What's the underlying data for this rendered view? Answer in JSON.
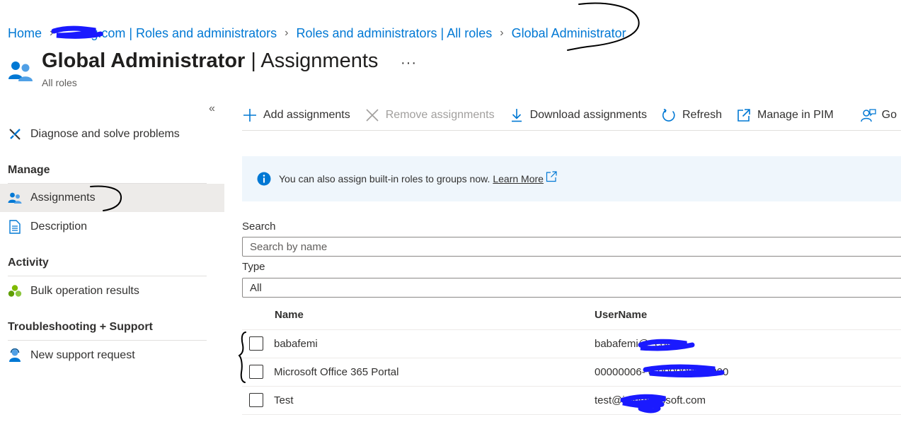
{
  "breadcrumb": {
    "items": [
      {
        "label": "Home"
      },
      {
        "label": "g.com | Roles and administrators"
      },
      {
        "label": "Roles and administrators | All roles"
      },
      {
        "label": "Global Administrator"
      }
    ]
  },
  "header": {
    "title_bold": "Global Administrator",
    "title_rest": " | Assignments",
    "more": "···",
    "subtitle": "All roles"
  },
  "sidebar": {
    "collapse": "«",
    "diagnose": "Diagnose and solve problems",
    "manage_heading": "Manage",
    "assignments": "Assignments",
    "description": "Description",
    "activity_heading": "Activity",
    "bulk": "Bulk operation results",
    "troubleshooting_heading": "Troubleshooting + Support",
    "support": "New support request"
  },
  "toolbar": {
    "add": "Add assignments",
    "remove": "Remove assignments",
    "download": "Download assignments",
    "refresh": "Refresh",
    "pim": "Manage in PIM",
    "got": "Go"
  },
  "info": {
    "text": "You can also assign built-in roles to groups now.",
    "link": "Learn More"
  },
  "filters": {
    "search_label": "Search",
    "search_placeholder": "Search by name",
    "type_label": "Type",
    "type_value": "All"
  },
  "table": {
    "headers": {
      "name": "Name",
      "username": "UserName"
    },
    "rows": [
      {
        "name": "babafemi",
        "username": "babafemi@              .com"
      },
      {
        "name": "Microsoft Office 365 Portal",
        "username": "00000006-                    0-000000000000"
      },
      {
        "name": "Test",
        "username": "test@i                onmicrosoft.com"
      }
    ]
  },
  "colors": {
    "link": "#0078d4",
    "info_bg": "#eff6fc",
    "active_bg": "#edebe9",
    "redaction": "#1a1aff"
  }
}
